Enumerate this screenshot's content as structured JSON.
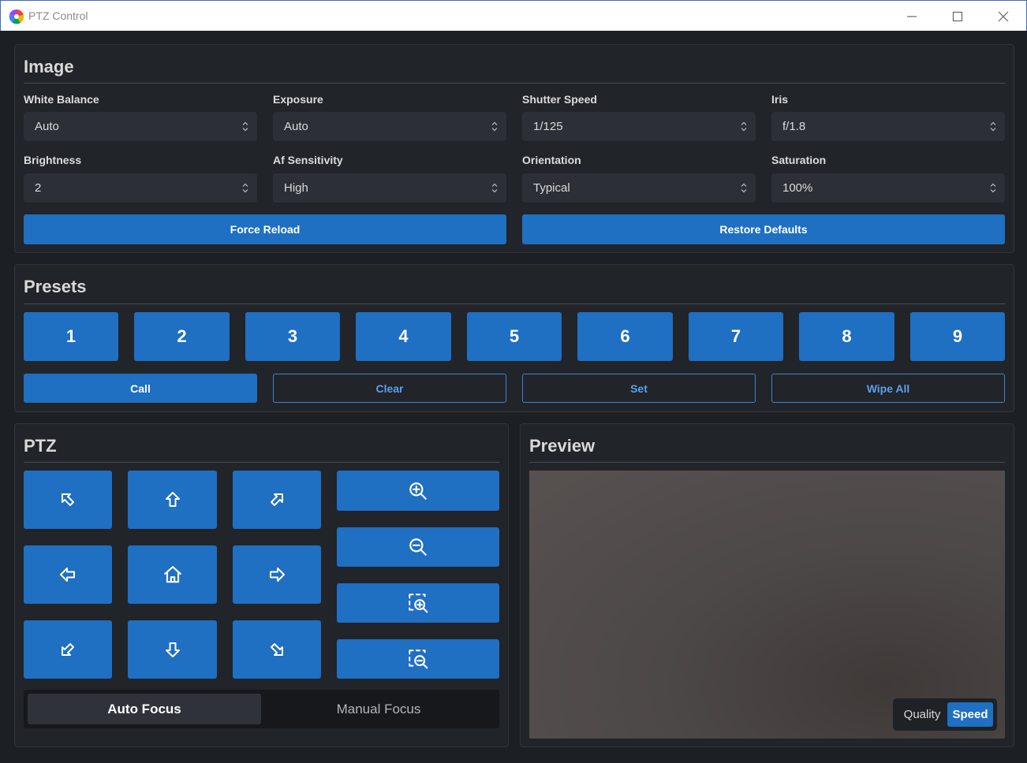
{
  "window": {
    "title": "PTZ Control",
    "controls": {
      "minimize": "minimize-icon",
      "maximize": "maximize-icon",
      "close": "close-icon"
    }
  },
  "image": {
    "title": "Image",
    "fields": [
      {
        "label": "White Balance",
        "value": "Auto"
      },
      {
        "label": "Exposure",
        "value": "Auto"
      },
      {
        "label": "Shutter Speed",
        "value": "1/125"
      },
      {
        "label": "Iris",
        "value": "f/1.8"
      },
      {
        "label": "Brightness",
        "value": "2"
      },
      {
        "label": "Af Sensitivity",
        "value": "High"
      },
      {
        "label": "Orientation",
        "value": "Typical"
      },
      {
        "label": "Saturation",
        "value": "100%"
      }
    ],
    "force_reload": "Force Reload",
    "restore_defaults": "Restore Defaults"
  },
  "presets": {
    "title": "Presets",
    "numbers": [
      "1",
      "2",
      "3",
      "4",
      "5",
      "6",
      "7",
      "8",
      "9"
    ],
    "actions": {
      "call": "Call",
      "clear": "Clear",
      "set": "Set",
      "wipe_all": "Wipe All"
    }
  },
  "ptz": {
    "title": "PTZ",
    "direction_icons": [
      "arrow-up-left-icon",
      "arrow-up-icon",
      "arrow-up-right-icon",
      "arrow-left-icon",
      "home-icon",
      "arrow-right-icon",
      "arrow-down-left-icon",
      "arrow-down-icon",
      "arrow-down-right-icon"
    ],
    "zoom_icons": [
      "zoom-in-icon",
      "zoom-out-icon",
      "focus-near-icon",
      "focus-far-icon"
    ],
    "focus": {
      "auto": "Auto Focus",
      "manual": "Manual Focus",
      "selected": "auto"
    }
  },
  "preview": {
    "title": "Preview",
    "quality": "Quality",
    "speed": "Speed",
    "selected": "speed"
  },
  "colors": {
    "accent": "#1f6fc2",
    "panel_bg": "#212429",
    "app_bg": "#1c1f24"
  }
}
